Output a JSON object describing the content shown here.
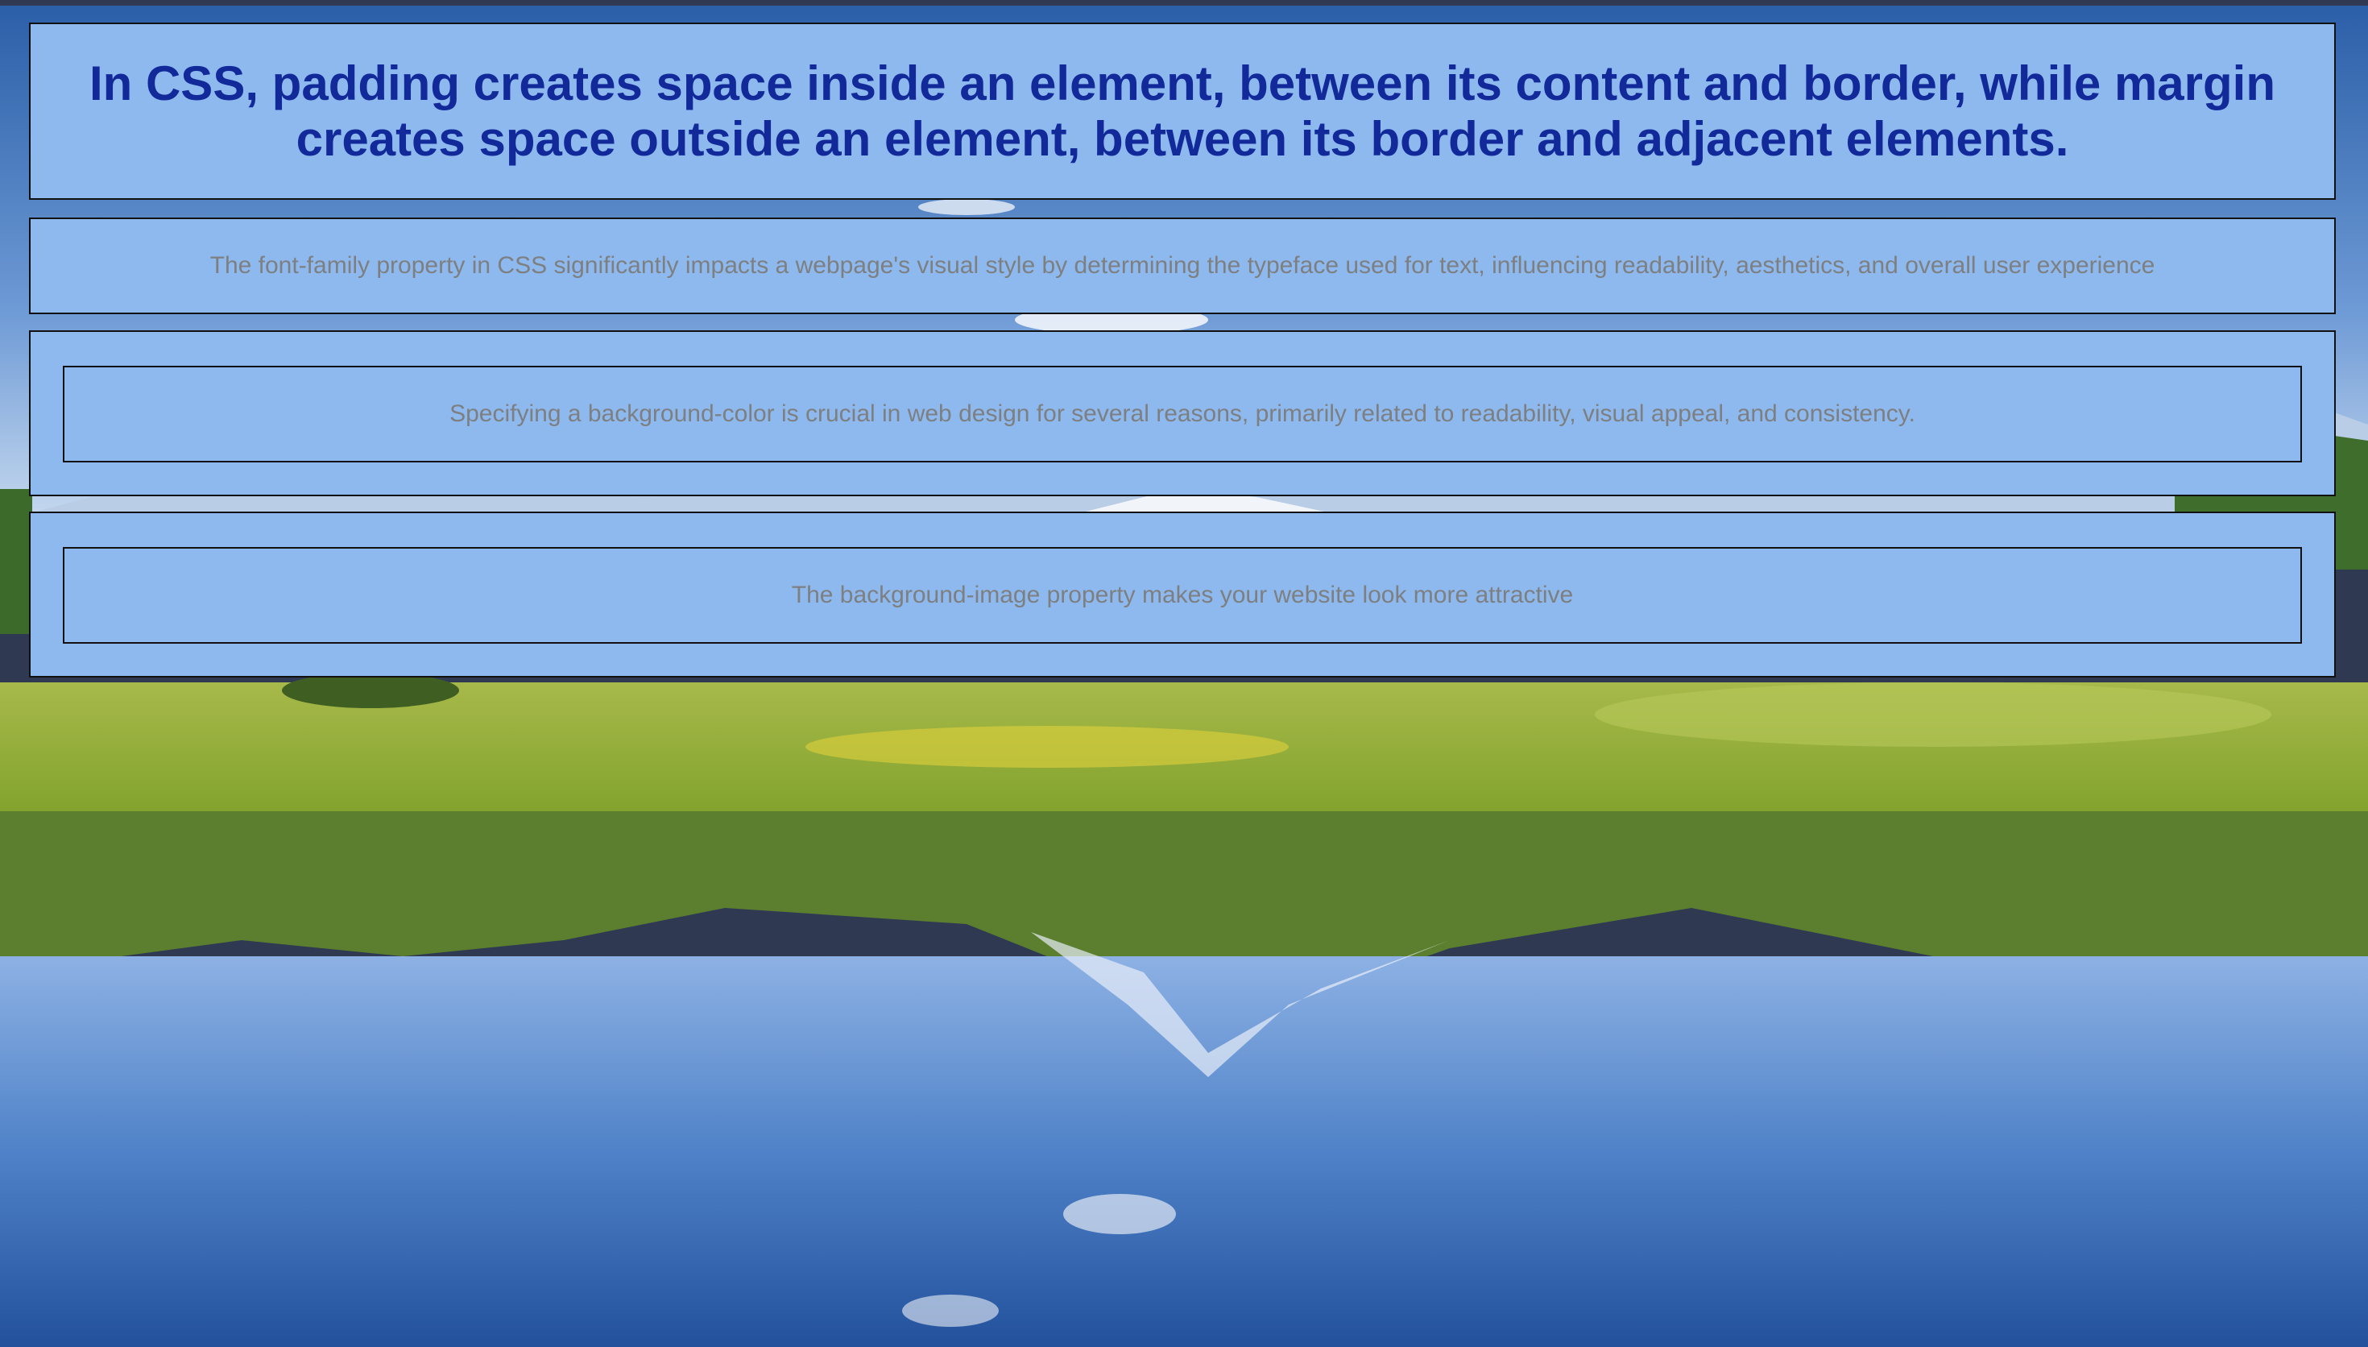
{
  "background": {
    "image": "mountain-lake-reflection",
    "sky_color": "#7ea4d6",
    "grass_color": "#9bb83c",
    "water_color": "#3a6fb8"
  },
  "colors": {
    "panel_background": "#8eb9ef",
    "panel_border": "#111111",
    "heading_text": "#12299a",
    "body_text": "#7d7f80"
  },
  "heading": {
    "text": "In CSS, padding creates space inside an element, between its content and border, while margin creates space outside an element, between its border and adjacent elements."
  },
  "paragraphs": {
    "font_family": "The font-family property in CSS significantly impacts a webpage's visual style by determining the typeface used for text, influencing readability, aesthetics, and overall user experience",
    "background_color": "Specifying a background-color is crucial in web design for several reasons, primarily related to readability, visual appeal, and consistency.",
    "background_image": "The background-image property makes your website look more attractive"
  }
}
